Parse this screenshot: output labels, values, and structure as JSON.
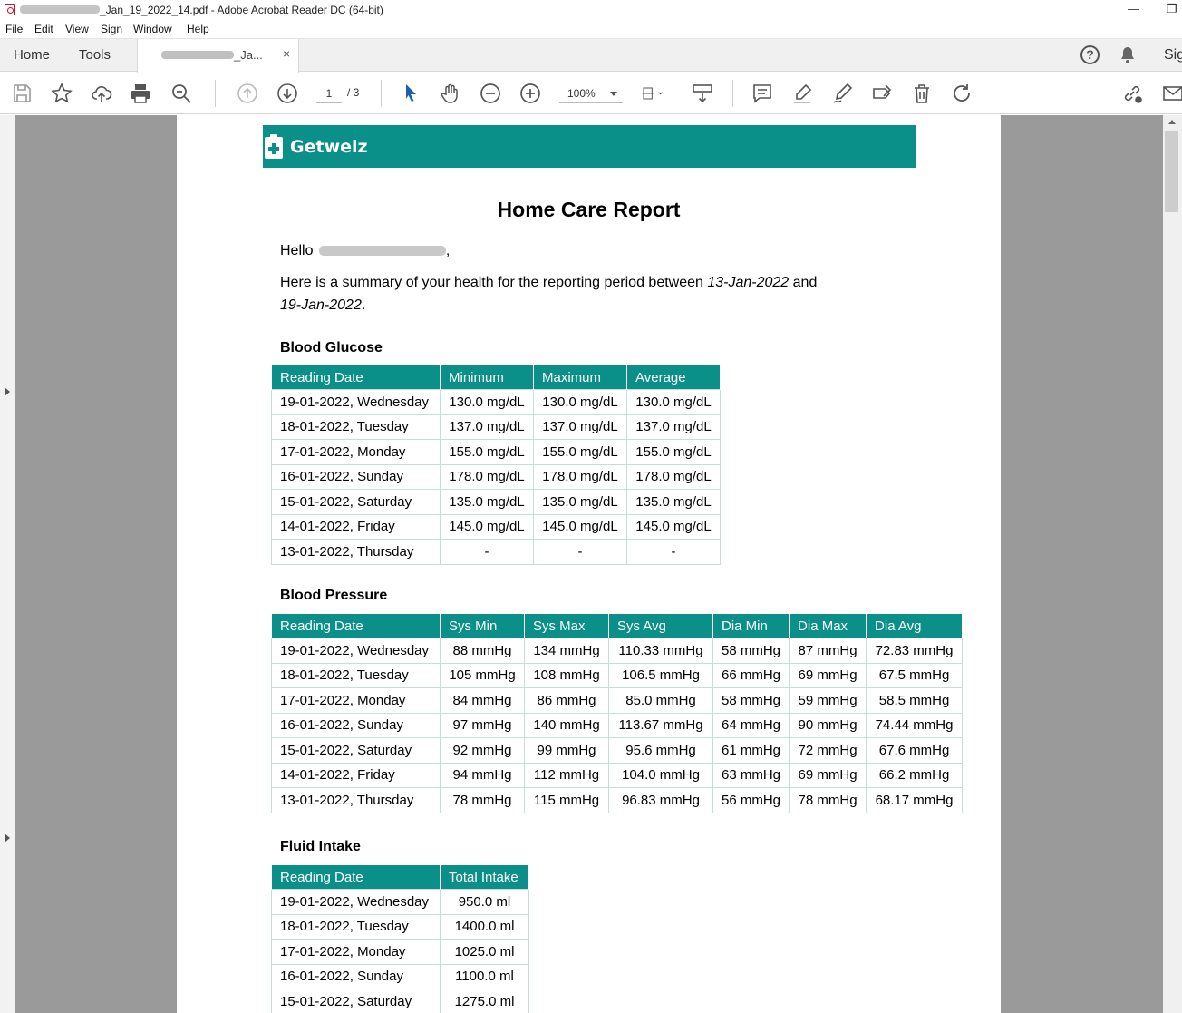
{
  "window": {
    "title_visible": "_Jan_19_2022_14.pdf - Adobe Acrobat Reader DC (64-bit)",
    "minimize_glyph": "—",
    "restore_glyph": "❐"
  },
  "menu": [
    "File",
    "Edit",
    "View",
    "Sign",
    "Window",
    "Help"
  ],
  "tabs": {
    "home": "Home",
    "tools": "Tools",
    "document_suffix": "_Ja...",
    "close_glyph": "×",
    "help_glyph": "?",
    "sign": "Sig"
  },
  "toolbar": {
    "page_current": "1",
    "page_total": "/ 3",
    "zoom": "100%",
    "icons": [
      "save-icon",
      "bookmark-star-icon",
      "upload-cloud-icon",
      "print-icon",
      "search-zoom-icon",
      "page-up-icon",
      "page-down-icon",
      "select-cursor-icon",
      "hand-icon",
      "zoom-out-icon",
      "zoom-in-icon",
      "fit-page-icon",
      "scroll-mode-icon",
      "comment-icon",
      "highlight-icon",
      "sign-pen-icon",
      "fill-sign-icon",
      "delete-icon",
      "rotate-icon",
      "share-link-icon",
      "email-icon"
    ]
  },
  "document": {
    "brand": "Getwelz",
    "brand_color": "#0a9088",
    "title": "Home Care Report",
    "greeting": "Hello",
    "greeting_end": ",",
    "summary_pre": "Here is a summary of your health for the reporting period between ",
    "period_start": "13-Jan-2022",
    "summary_mid": " and ",
    "period_end": "19-Jan-2022",
    "summary_post": ".",
    "blood_glucose": {
      "heading": "Blood Glucose",
      "columns": [
        "Reading Date",
        "Minimum",
        "Maximum",
        "Average"
      ],
      "rows": [
        [
          "19-01-2022, Wednesday",
          "130.0 mg/dL",
          "130.0 mg/dL",
          "130.0 mg/dL"
        ],
        [
          "18-01-2022, Tuesday",
          "137.0 mg/dL",
          "137.0 mg/dL",
          "137.0 mg/dL"
        ],
        [
          "17-01-2022, Monday",
          "155.0 mg/dL",
          "155.0 mg/dL",
          "155.0 mg/dL"
        ],
        [
          "16-01-2022, Sunday",
          "178.0 mg/dL",
          "178.0 mg/dL",
          "178.0 mg/dL"
        ],
        [
          "15-01-2022, Saturday",
          "135.0 mg/dL",
          "135.0 mg/dL",
          "135.0 mg/dL"
        ],
        [
          "14-01-2022, Friday",
          "145.0 mg/dL",
          "145.0 mg/dL",
          "145.0 mg/dL"
        ],
        [
          "13-01-2022, Thursday",
          "-",
          "-",
          "-"
        ]
      ]
    },
    "blood_pressure": {
      "heading": "Blood Pressure",
      "columns": [
        "Reading Date",
        "Sys Min",
        "Sys Max",
        "Sys Avg",
        "Dia Min",
        "Dia Max",
        "Dia Avg"
      ],
      "rows": [
        [
          "19-01-2022, Wednesday",
          "88 mmHg",
          "134 mmHg",
          "110.33 mmHg",
          "58 mmHg",
          "87 mmHg",
          "72.83 mmHg"
        ],
        [
          "18-01-2022, Tuesday",
          "105 mmHg",
          "108 mmHg",
          "106.5 mmHg",
          "66 mmHg",
          "69 mmHg",
          "67.5 mmHg"
        ],
        [
          "17-01-2022, Monday",
          "84 mmHg",
          "86 mmHg",
          "85.0 mmHg",
          "58 mmHg",
          "59 mmHg",
          "58.5 mmHg"
        ],
        [
          "16-01-2022, Sunday",
          "97 mmHg",
          "140 mmHg",
          "113.67 mmHg",
          "64 mmHg",
          "90 mmHg",
          "74.44 mmHg"
        ],
        [
          "15-01-2022, Saturday",
          "92 mmHg",
          "99 mmHg",
          "95.6 mmHg",
          "61 mmHg",
          "72 mmHg",
          "67.6 mmHg"
        ],
        [
          "14-01-2022, Friday",
          "94 mmHg",
          "112 mmHg",
          "104.0 mmHg",
          "63 mmHg",
          "69 mmHg",
          "66.2 mmHg"
        ],
        [
          "13-01-2022, Thursday",
          "78 mmHg",
          "115 mmHg",
          "96.83 mmHg",
          "56 mmHg",
          "78 mmHg",
          "68.17 mmHg"
        ]
      ]
    },
    "fluid_intake": {
      "heading": "Fluid Intake",
      "columns": [
        "Reading Date",
        "Total Intake"
      ],
      "rows": [
        [
          "19-01-2022, Wednesday",
          "950.0 ml"
        ],
        [
          "18-01-2022, Tuesday",
          "1400.0 ml"
        ],
        [
          "17-01-2022, Monday",
          "1025.0 ml"
        ],
        [
          "16-01-2022, Sunday",
          "1100.0 ml"
        ],
        [
          "15-01-2022, Saturday",
          "1275.0 ml"
        ]
      ]
    }
  }
}
